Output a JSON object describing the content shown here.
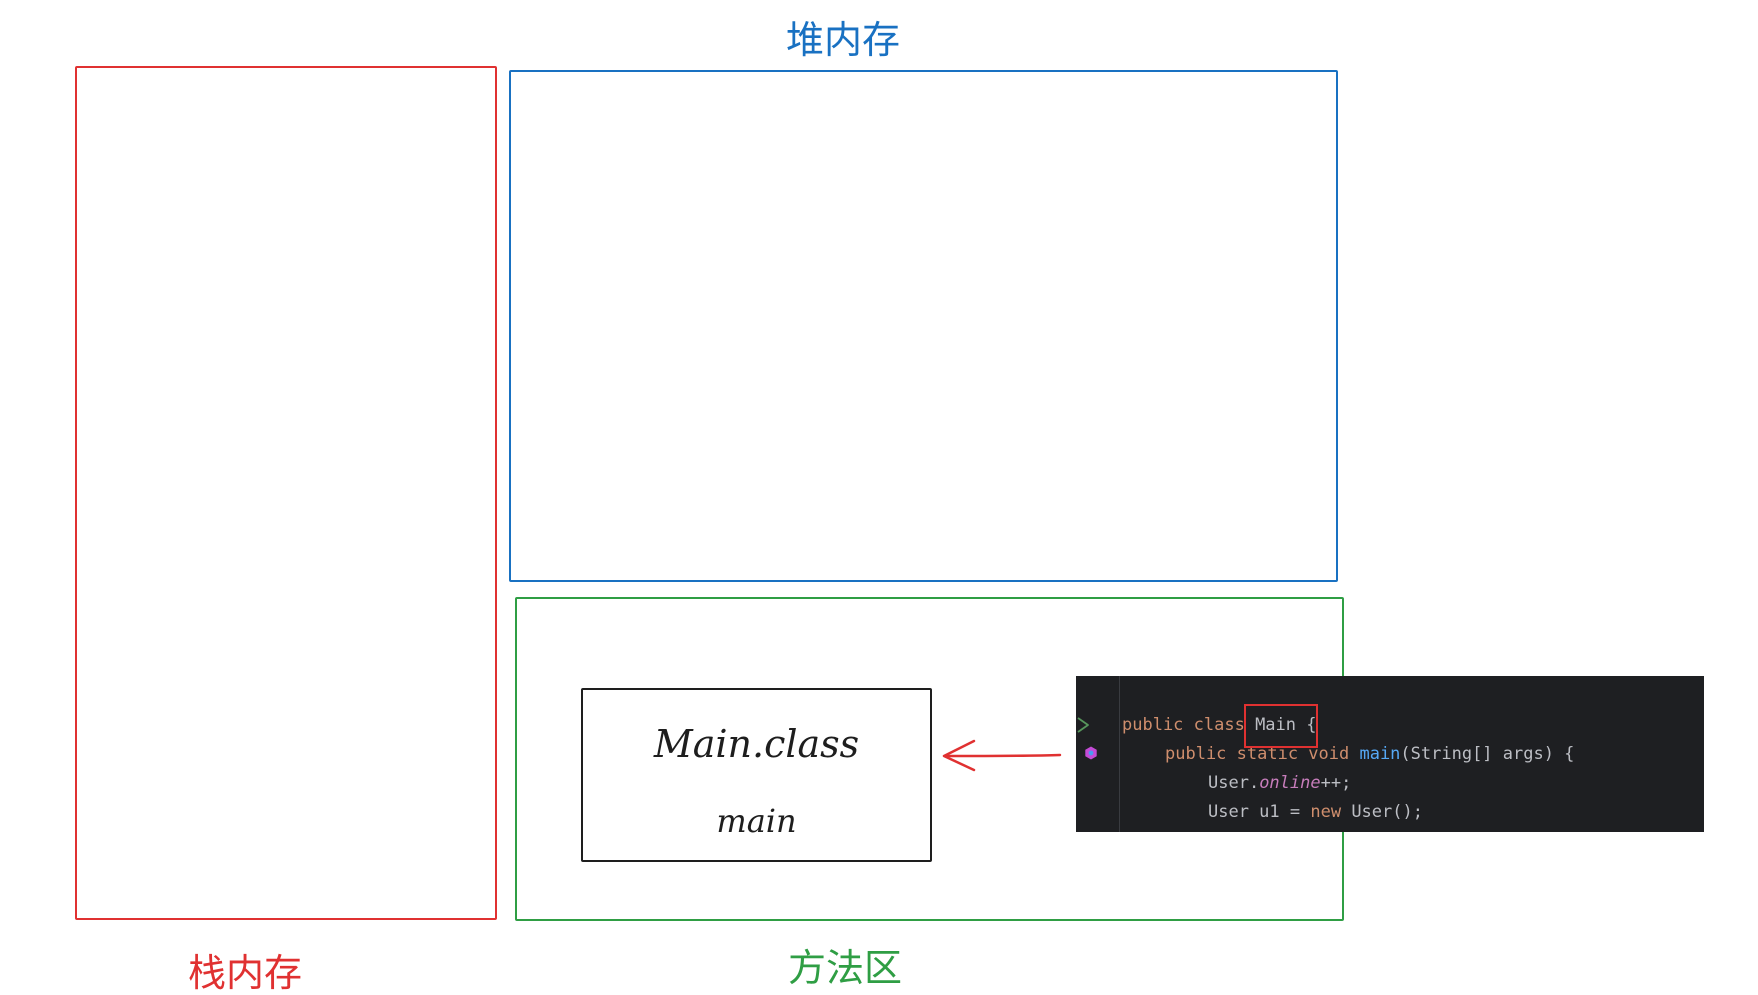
{
  "regions": {
    "heap_label": "堆内存",
    "stack_label": "栈内存",
    "method_area_label": "方法区"
  },
  "class_box": {
    "class_name": "Main.class",
    "method_name": "main"
  },
  "code": {
    "line1": {
      "kw": "public class ",
      "name": "Main",
      "rest": " {"
    },
    "line2": {
      "kw": "public static void ",
      "fn": "main",
      "rest": "(String[] args) {"
    },
    "line3": {
      "pre": "User.",
      "field": "online",
      "rest": "++;"
    },
    "line4": {
      "pre": "User u1 = ",
      "kw": "new",
      "rest": " User();"
    }
  },
  "colors": {
    "stack": "#e03131",
    "heap": "#1971c2",
    "method_area": "#2f9e44",
    "code_bg": "#1e1f22"
  },
  "icons": {
    "run_gutter": "run-triangle-icon",
    "debug_gutter": "debug-hexagon-icon",
    "arrow": "arrow-left-icon"
  }
}
